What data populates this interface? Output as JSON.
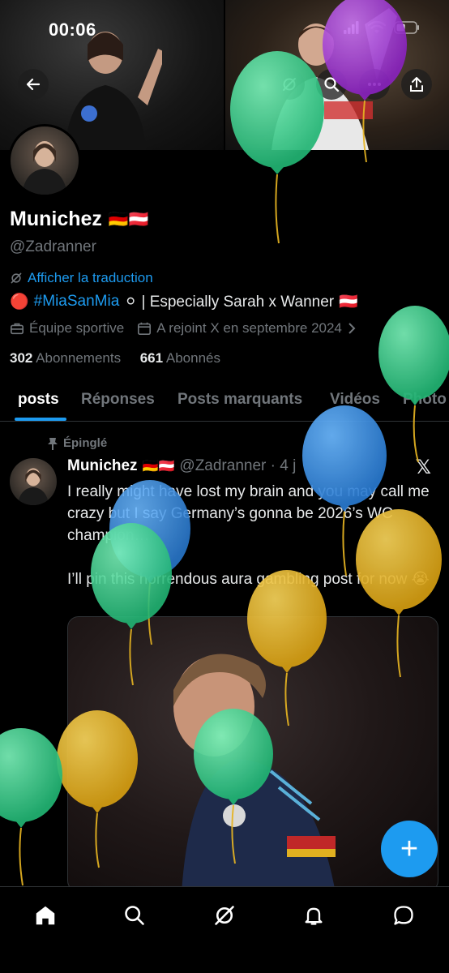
{
  "status_bar": {
    "time": "00:06"
  },
  "header": {
    "back_icon": "back-arrow-icon",
    "grok_icon": "grok-icon",
    "search_icon": "search-icon",
    "more_icon": "more-icon",
    "share_icon": "share-icon"
  },
  "profile": {
    "display_name": "Munichez",
    "name_flags": "🇩🇪🇦🇹",
    "handle": "@Zadranner",
    "translate_label": "Afficher la traduction",
    "bio_prefix": "🔴",
    "bio_hashtag": "#MiaSanMia",
    "bio_rest": "⚪ | Especially Sarah x Wanner",
    "bio_flag": "🇦🇹",
    "category": "Équipe sportive",
    "joined": "A rejoint X en septembre 2024",
    "following_count": "302",
    "following_label": "Abonnements",
    "followers_count": "661",
    "followers_label": "Abonnés"
  },
  "tabs": [
    "posts",
    "Réponses",
    "Posts marquants",
    "Vidéos",
    "Photo"
  ],
  "post": {
    "pinned_label": "Épinglé",
    "name": "Munichez",
    "flags": "🇩🇪🇦🇹",
    "handle_time": "@Zadranner · 4 j",
    "text_1": "I really might have lost my brain and you may call me crazy but I say Germany’s gonna be 2026’s WC champion…",
    "text_2": "I’ll pin this horrendous aura gambling post for now 😭"
  },
  "fab_label": "+",
  "colors": {
    "accent": "#1d9bf0",
    "muted": "#71767b",
    "balloon_green": "#3ecf8e",
    "balloon_yellow": "#e6b422",
    "balloon_blue": "#3b8fe0",
    "balloon_purple": "#a33bd8"
  }
}
